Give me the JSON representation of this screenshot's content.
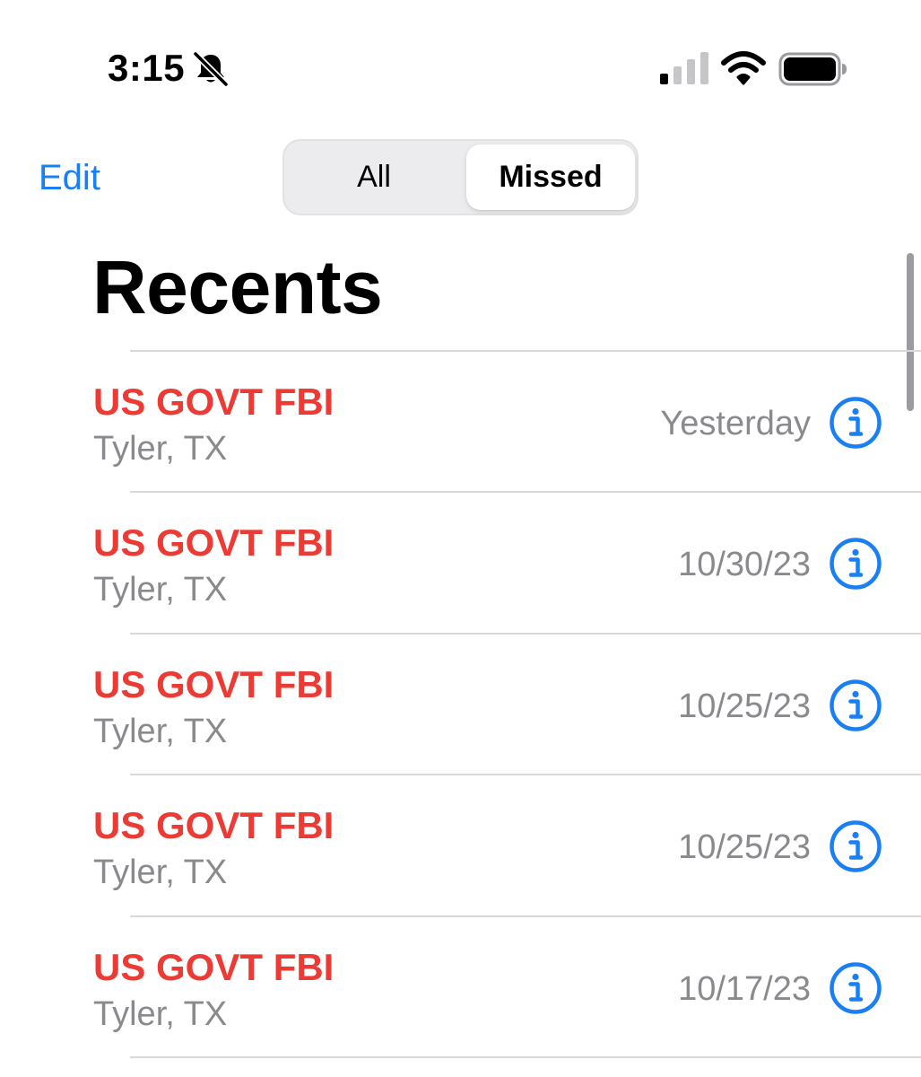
{
  "status_bar": {
    "time": "3:15",
    "silent_icon": "bell-slash-icon",
    "signal_icon": "cellular-signal-icon",
    "signal_bars_active": 1,
    "signal_bars_total": 4,
    "wifi_icon": "wifi-icon",
    "battery_icon": "battery-icon",
    "battery_level": 1.0
  },
  "nav": {
    "edit_label": "Edit",
    "segments": [
      {
        "label": "All",
        "selected": false
      },
      {
        "label": "Missed",
        "selected": true
      }
    ]
  },
  "title": "Recents",
  "calls": [
    {
      "name": "US GOVT FBI",
      "location": "Tyler, TX",
      "date": "Yesterday"
    },
    {
      "name": "US GOVT FBI",
      "location": "Tyler, TX",
      "date": "10/30/23"
    },
    {
      "name": "US GOVT FBI",
      "location": "Tyler, TX",
      "date": "10/25/23"
    },
    {
      "name": "US GOVT FBI",
      "location": "Tyler, TX",
      "date": "10/25/23"
    },
    {
      "name": "US GOVT FBI",
      "location": "Tyler, TX",
      "date": "10/17/23"
    }
  ],
  "colors": {
    "accent": "#1a7ff2",
    "missed_call": "#ec3b34",
    "secondary_text": "#8a8a8e",
    "separator": "#d9d9dc"
  }
}
